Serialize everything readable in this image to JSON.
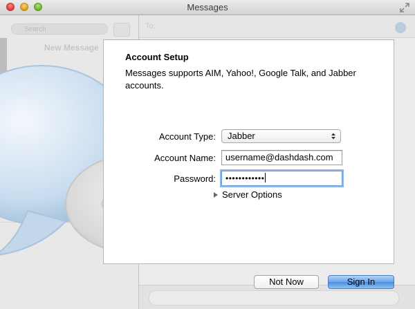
{
  "window": {
    "title": "Messages"
  },
  "background": {
    "search_placeholder": "Search",
    "new_message_label": "New Message",
    "to_label": "To:"
  },
  "dialog": {
    "heading": "Account Setup",
    "description": "Messages supports AIM, Yahoo!, Google Talk, and Jabber accounts.",
    "account_type": {
      "label": "Account Type:",
      "selected": "Jabber"
    },
    "account_name": {
      "label": "Account Name:",
      "value": "username@dashdash.com"
    },
    "password": {
      "label": "Password:",
      "masked_value": "••••••••••••"
    },
    "server_options_label": "Server Options",
    "buttons": {
      "not_now": "Not Now",
      "sign_in": "Sign In"
    }
  },
  "colors": {
    "accent": "#4a8de0",
    "focus_ring": "#8db6ea"
  }
}
